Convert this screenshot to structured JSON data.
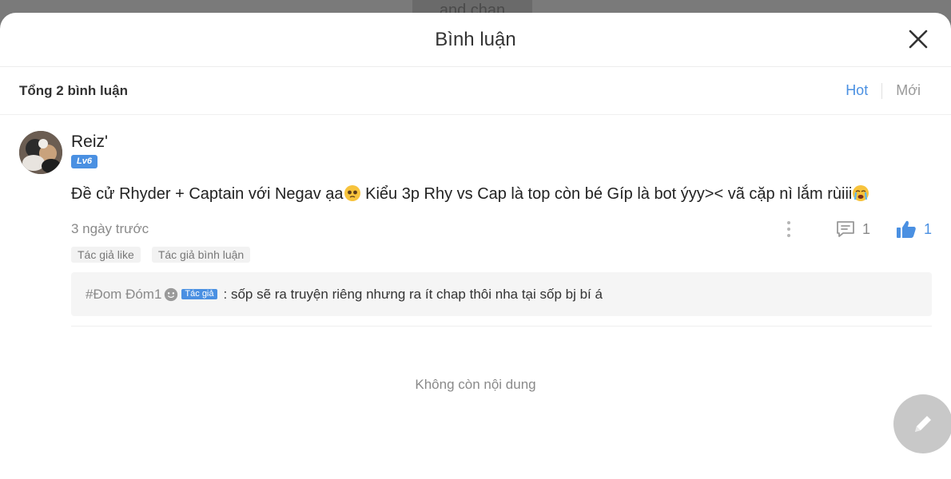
{
  "backdrop": {
    "title_fragment": "and chan"
  },
  "modal": {
    "title": "Bình luận"
  },
  "toolbar": {
    "total_label": "Tổng 2 bình luận",
    "sort_hot": "Hot",
    "sort_new": "Mới"
  },
  "comment": {
    "username": "Reiz'",
    "level": "Lv6",
    "text_part1": "Đề cử Rhyder + Captain với Negav ạa",
    "text_part2": " Kiểu 3p Rhy vs Cap là top còn bé Gíp là bot ýyy>< vã cặp nì lắm rùiii",
    "time": "3 ngày trước",
    "reply_count": "1",
    "like_count": "1",
    "tags": [
      "Tác giả like",
      "Tác giả bình luận"
    ],
    "reply": {
      "user": "#Đom Đóm1",
      "author_badge": "Tác giả",
      "text": ": sốp sẽ ra truyện riêng nhưng ra ít chap thôi nha tại sốp bj bí á"
    }
  },
  "footer": {
    "no_more": "Không còn nội dung"
  },
  "colors": {
    "accent": "#4a90e2",
    "muted": "#8a8a8a",
    "fab": "#c8c8c8"
  },
  "icons": [
    "close-icon",
    "more-icon",
    "reply-icon",
    "like-icon",
    "pencil-icon"
  ]
}
